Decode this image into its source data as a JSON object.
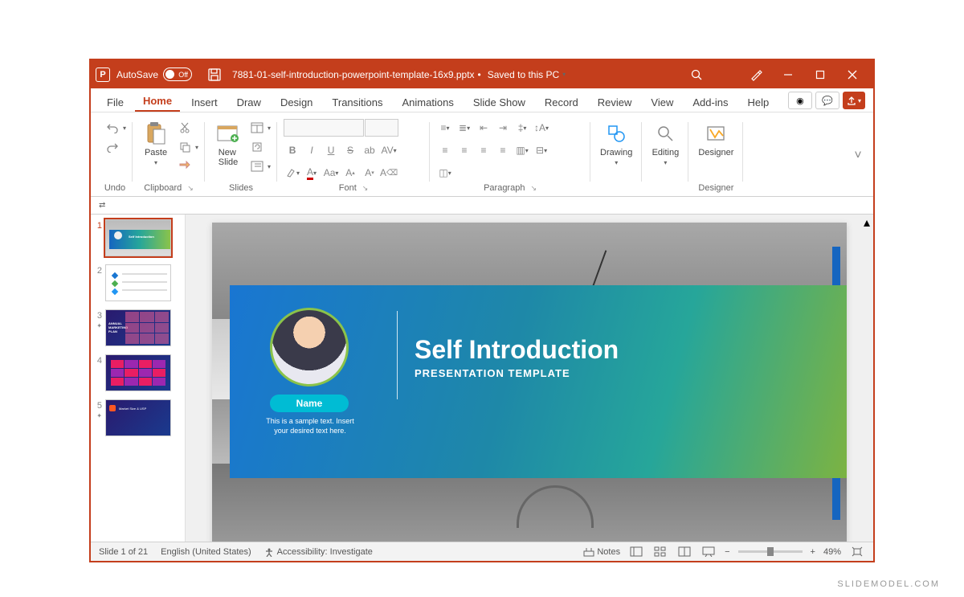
{
  "titlebar": {
    "autosave_label": "AutoSave",
    "autosave_state": "Off",
    "filename": "7881-01-self-introduction-powerpoint-template-16x9.pptx",
    "saved_status": "Saved to this PC"
  },
  "tabs": {
    "file": "File",
    "home": "Home",
    "insert": "Insert",
    "draw": "Draw",
    "design": "Design",
    "transitions": "Transitions",
    "animations": "Animations",
    "slideshow": "Slide Show",
    "record": "Record",
    "review": "Review",
    "view": "View",
    "addins": "Add-ins",
    "help": "Help"
  },
  "ribbon": {
    "undo_group": "Undo",
    "clipboard_group": "Clipboard",
    "paste": "Paste",
    "slides_group": "Slides",
    "new_slide": "New\nSlide",
    "font_group": "Font",
    "paragraph_group": "Paragraph",
    "drawing": "Drawing",
    "editing": "Editing",
    "designer_group": "Designer",
    "designer": "Designer"
  },
  "thumbnails": {
    "n1": "1",
    "n2": "2",
    "n3": "3",
    "n4": "4",
    "n5": "5",
    "t1_text": "Self Introduction"
  },
  "slide": {
    "title": "Self Introduction",
    "subtitle": "PRESENTATION TEMPLATE",
    "name": "Name",
    "sample": "This is a sample text. Insert your desired text here."
  },
  "statusbar": {
    "slide_info": "Slide 1 of 21",
    "language": "English (United States)",
    "accessibility": "Accessibility: Investigate",
    "notes": "Notes",
    "zoom_pct": "49%"
  },
  "brand": "SLIDEMODEL.COM"
}
